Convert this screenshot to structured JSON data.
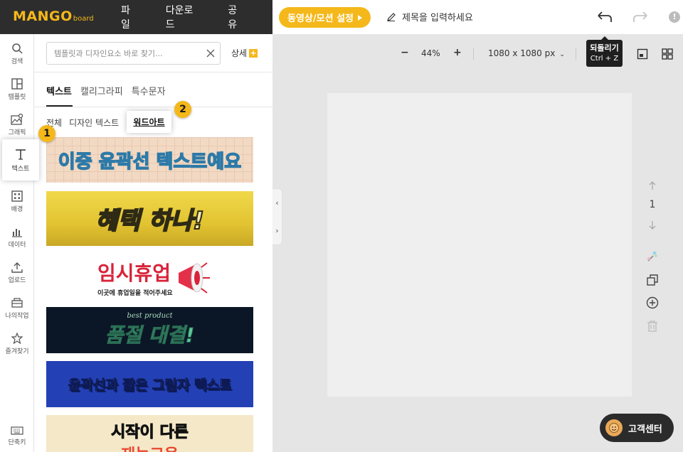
{
  "app": {
    "logo_main": "MANGO",
    "logo_sub": "board"
  },
  "top_menu": [
    "파일",
    "다운로드",
    "공유"
  ],
  "motion_button": "동영상/모션 설정",
  "title_placeholder": "제목을 입력하세요",
  "tooltip": {
    "title": "되돌리기",
    "shortcut": "Ctrl + Z"
  },
  "warn_icon": "!",
  "rail": [
    {
      "label": "검색",
      "icon": "search-icon"
    },
    {
      "label": "템플릿",
      "icon": "template-icon"
    },
    {
      "label": "그래픽",
      "icon": "graphic-icon"
    },
    {
      "label": "텍스트",
      "icon": "text-icon"
    },
    {
      "label": "배경",
      "icon": "background-icon"
    },
    {
      "label": "데이터",
      "icon": "chart-icon"
    },
    {
      "label": "업로드",
      "icon": "upload-icon"
    },
    {
      "label": "나의작업",
      "icon": "my-work-icon"
    },
    {
      "label": "즐겨찾기",
      "icon": "star-icon"
    },
    {
      "label": "단축키",
      "icon": "keyboard-icon"
    }
  ],
  "panel": {
    "search_placeholder": "템플릿과 디자인요소 바로 찾기...",
    "detail_label": "상세",
    "detail_plus": "+",
    "tabs": [
      "텍스트",
      "캘리그라피",
      "특수문자"
    ],
    "subtabs": [
      "전체",
      "디자인 텍스트",
      "워드아트"
    ],
    "wordart": [
      {
        "text": "이중 윤곽선 텍스트예요",
        "bg": "#f2d9c4",
        "fg": "#e9538f"
      },
      {
        "text": "혜택 하나!",
        "bg": "#e8cc3a",
        "fg": "#6b5a1b"
      },
      {
        "text": "임시휴업",
        "sub": "이곳에 휴업일을 적어주세요",
        "bg": "#ffffff",
        "fg": "#d8233a"
      },
      {
        "text": "품절 대결!",
        "sub": "best product",
        "bg": "#0b1626",
        "fg": "#5cc99a"
      },
      {
        "text": "윤곽선과 짧은 그림자 텍스트",
        "bg": "#2340b5",
        "fg": "#ffffff"
      },
      {
        "text": "시작이 다른",
        "sub": "재능교육",
        "bg": "#f4e8c8",
        "fg": "#333333"
      }
    ]
  },
  "badges": {
    "one": "1",
    "two": "2"
  },
  "canvas_toolbar": {
    "zoom_minus": "−",
    "zoom": "44%",
    "zoom_plus": "+",
    "size": "1080 x 1080 px"
  },
  "collapse": {
    "up": "‹",
    "down": "›"
  },
  "side_tools": {
    "page": "1"
  },
  "help": "고객센터",
  "colors": {
    "brand": "#f5b81a",
    "dark": "#2d2d2d"
  }
}
